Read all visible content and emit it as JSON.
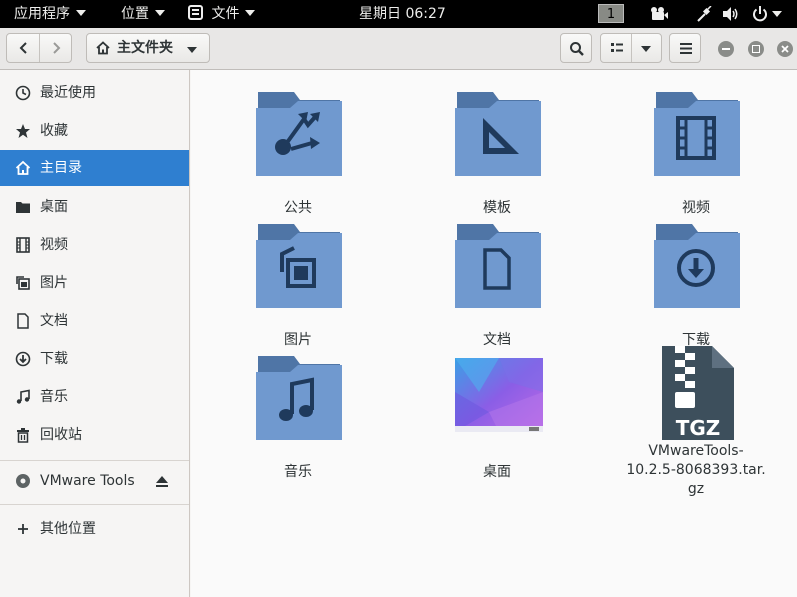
{
  "topbar": {
    "apps_menu": "应用程序",
    "places_menu": "位置",
    "files_app_menu": "文件",
    "clock": "星期日 06:27",
    "workspace_indicator": "1"
  },
  "headerbar": {
    "path_button_label": "主文件夹"
  },
  "sidebar": {
    "items": [
      {
        "label": "最近使用",
        "icon": "clock-icon"
      },
      {
        "label": "收藏",
        "icon": "star-icon"
      },
      {
        "label": "主目录",
        "icon": "home-icon",
        "active": true
      },
      {
        "label": "桌面",
        "icon": "folder-icon"
      },
      {
        "label": "视频",
        "icon": "film-icon"
      },
      {
        "label": "图片",
        "icon": "picture-icon"
      },
      {
        "label": "文档",
        "icon": "document-icon"
      },
      {
        "label": "下载",
        "icon": "download-icon"
      },
      {
        "label": "音乐",
        "icon": "music-icon"
      },
      {
        "label": "回收站",
        "icon": "trash-icon"
      }
    ],
    "device": {
      "label": "VMware Tools",
      "icon": "disc-icon"
    },
    "other_locations": "其他位置"
  },
  "files": [
    {
      "name": "公共",
      "icon": "folder-public-icon"
    },
    {
      "name": "模板",
      "icon": "folder-templates-icon"
    },
    {
      "name": "视频",
      "icon": "folder-videos-icon"
    },
    {
      "name": "图片",
      "icon": "folder-pictures-icon"
    },
    {
      "name": "文档",
      "icon": "folder-documents-icon"
    },
    {
      "name": "下载",
      "icon": "folder-download-icon"
    },
    {
      "name": "音乐",
      "icon": "folder-music-icon"
    },
    {
      "name": "桌面",
      "icon": "desktop-thumbnail-icon"
    },
    {
      "name_lines": [
        "VMwareTools-",
        "10.2.5-8068393.tar.",
        "gz"
      ],
      "badge": "TGZ",
      "icon": "archive-tgz-icon"
    }
  ],
  "colors": {
    "selection": "#2f7fd0",
    "folder_body": "#6f98cf",
    "folder_tab": "#4f75a6",
    "emblem": "#1f3a5c",
    "archive": "#3d4f5c"
  }
}
